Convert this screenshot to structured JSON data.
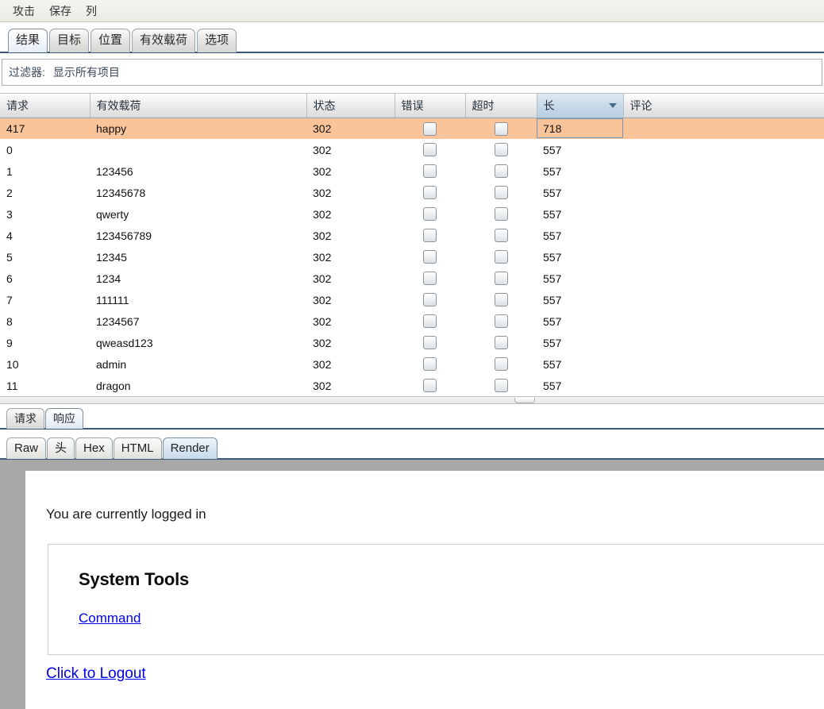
{
  "menubar": {
    "items": [
      {
        "label": "攻击"
      },
      {
        "label": "保存"
      },
      {
        "label": "列"
      }
    ]
  },
  "main_tabs": {
    "selected": "结果",
    "items": [
      {
        "label": "结果"
      },
      {
        "label": "目标"
      },
      {
        "label": "位置"
      },
      {
        "label": "有效载荷"
      },
      {
        "label": "选项"
      }
    ]
  },
  "filter": {
    "label": "过滤器:",
    "value": "显示所有项目"
  },
  "results_table": {
    "sort_column": "长",
    "sort_direction": "descending",
    "columns": [
      {
        "key": "request",
        "label": "请求"
      },
      {
        "key": "payload",
        "label": "有效载荷"
      },
      {
        "key": "status",
        "label": "状态"
      },
      {
        "key": "error",
        "label": "错误"
      },
      {
        "key": "timeout",
        "label": "超时"
      },
      {
        "key": "length",
        "label": "长"
      },
      {
        "key": "comment",
        "label": "评论"
      }
    ],
    "rows": [
      {
        "request": "417",
        "payload": "happy",
        "status": "302",
        "error": false,
        "timeout": false,
        "length": "718",
        "comment": "",
        "selected": true
      },
      {
        "request": "0",
        "payload": "",
        "status": "302",
        "error": false,
        "timeout": false,
        "length": "557",
        "comment": "",
        "selected": false
      },
      {
        "request": "1",
        "payload": "123456",
        "status": "302",
        "error": false,
        "timeout": false,
        "length": "557",
        "comment": "",
        "selected": false
      },
      {
        "request": "2",
        "payload": "12345678",
        "status": "302",
        "error": false,
        "timeout": false,
        "length": "557",
        "comment": "",
        "selected": false
      },
      {
        "request": "3",
        "payload": "qwerty",
        "status": "302",
        "error": false,
        "timeout": false,
        "length": "557",
        "comment": "",
        "selected": false
      },
      {
        "request": "4",
        "payload": "123456789",
        "status": "302",
        "error": false,
        "timeout": false,
        "length": "557",
        "comment": "",
        "selected": false
      },
      {
        "request": "5",
        "payload": "12345",
        "status": "302",
        "error": false,
        "timeout": false,
        "length": "557",
        "comment": "",
        "selected": false
      },
      {
        "request": "6",
        "payload": "1234",
        "status": "302",
        "error": false,
        "timeout": false,
        "length": "557",
        "comment": "",
        "selected": false
      },
      {
        "request": "7",
        "payload": "111111",
        "status": "302",
        "error": false,
        "timeout": false,
        "length": "557",
        "comment": "",
        "selected": false
      },
      {
        "request": "8",
        "payload": "1234567",
        "status": "302",
        "error": false,
        "timeout": false,
        "length": "557",
        "comment": "",
        "selected": false
      },
      {
        "request": "9",
        "payload": "qweasd123",
        "status": "302",
        "error": false,
        "timeout": false,
        "length": "557",
        "comment": "",
        "selected": false
      },
      {
        "request": "10",
        "payload": "admin",
        "status": "302",
        "error": false,
        "timeout": false,
        "length": "557",
        "comment": "",
        "selected": false
      },
      {
        "request": "11",
        "payload": "dragon",
        "status": "302",
        "error": false,
        "timeout": false,
        "length": "557",
        "comment": "",
        "selected": false
      }
    ]
  },
  "message_tabs": {
    "selected": "响应",
    "items": [
      {
        "label": "请求"
      },
      {
        "label": "响应"
      }
    ]
  },
  "view_tabs": {
    "selected": "Render",
    "items": [
      {
        "label": "Raw"
      },
      {
        "label": "头"
      },
      {
        "label": "Hex"
      },
      {
        "label": "HTML"
      },
      {
        "label": "Render"
      }
    ]
  },
  "rendered_page": {
    "status_text": "You are currently logged in",
    "panel_title": "System Tools",
    "panel_link": "Command",
    "logout_link": "Click to Logout"
  },
  "colors": {
    "selected_row": "#fac49a",
    "sorted_header": "#c6d8e8",
    "tab_accent": "#3b5a78",
    "link": "#0000ee",
    "render_bg": "#a8a8a8"
  }
}
